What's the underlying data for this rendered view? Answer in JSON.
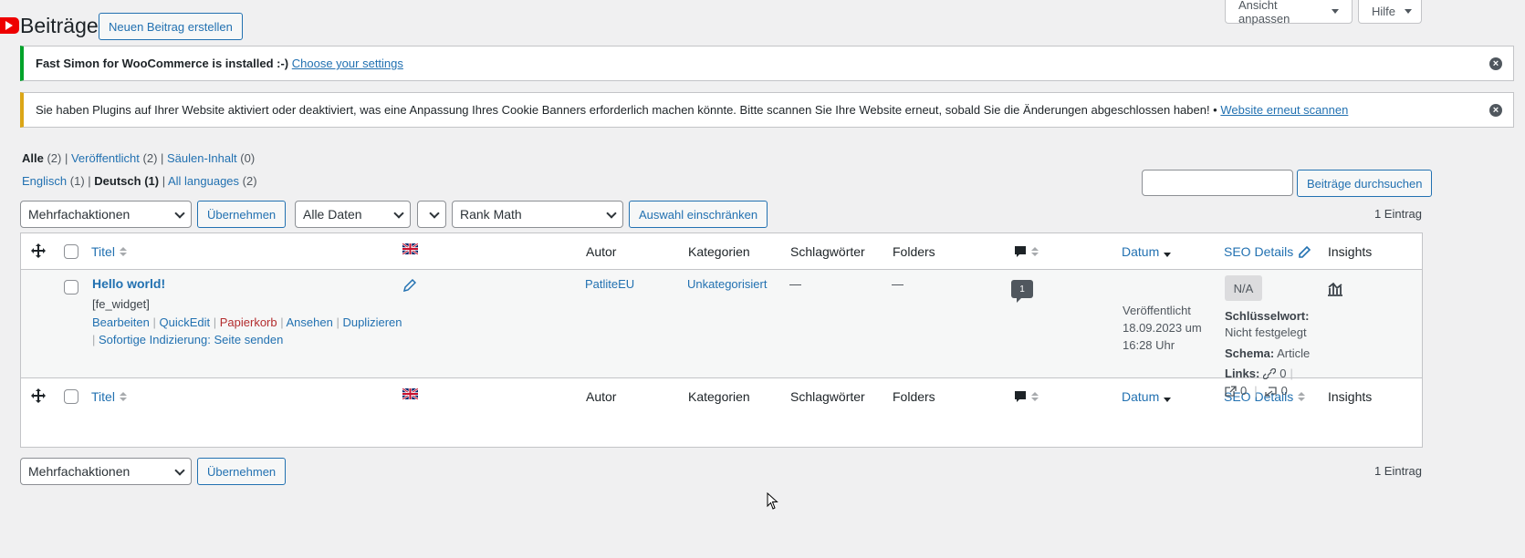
{
  "header": {
    "title": "Beiträge",
    "add_new": "Neuen Beitrag erstellen",
    "screen_options": "Ansicht anpassen",
    "help": "Hilfe"
  },
  "notices": {
    "fast_simon": {
      "text": "Fast Simon for WooCommerce is installed :-)",
      "link": "Choose your settings",
      "color": "#00a32a"
    },
    "cookie": {
      "text": "Sie haben Plugins auf Ihrer Website aktiviert oder deaktiviert, was eine Anpassung Ihres Cookie Banners erforderlich machen könnte. Bitte scannen Sie Ihre Website erneut, sobald Sie die Änderungen abgeschlossen haben! •",
      "link": "Website erneut scannen",
      "color": "#dba617"
    }
  },
  "views": {
    "all": "Alle",
    "all_count": "(2)",
    "published": "Veröffentlicht",
    "published_count": "(2)",
    "column_content": "Säulen-Inhalt",
    "column_content_count": "(0)"
  },
  "languages": {
    "english": "Englisch",
    "english_count": "(1)",
    "german": "Deutsch",
    "german_count": "(1)",
    "all": "All languages",
    "all_count": "(2)"
  },
  "search": {
    "value": "",
    "button": "Beiträge durchsuchen"
  },
  "filters": {
    "bulk_actions": "Mehrfachaktionen",
    "apply": "Übernehmen",
    "dates": "Alle Daten",
    "empty_select": "",
    "rank_math": "Rank Math",
    "filter_button": "Auswahl einschränken",
    "item_count": "1 Eintrag"
  },
  "columns": {
    "title": "Titel",
    "author": "Autor",
    "categories": "Kategorien",
    "tags": "Schlagwörter",
    "folders": "Folders",
    "date": "Datum",
    "seo": "SEO Details",
    "insights": "Insights"
  },
  "post": {
    "title": "Hello world!",
    "shortcode": "[fe_widget]",
    "actions": {
      "edit": "Bearbeiten",
      "quickedit": "QuickEdit",
      "trash": "Papierkorb",
      "view": "Ansehen",
      "duplicate": "Duplizieren",
      "indexing": "Sofortige Indizierung: Seite senden"
    },
    "author": "PatliteEU",
    "category": "Unkategorisiert",
    "tags": "—",
    "folders": "—",
    "comments": "1",
    "date_status": "Veröffentlicht",
    "date_line1": "18.09.2023 um",
    "date_line2": "16:28 Uhr",
    "seo": {
      "score": "N/A",
      "keyword_label": "Schlüsselwort:",
      "keyword_value": "Nicht festgelegt",
      "schema_label": "Schema:",
      "schema_value": "Article",
      "links_label": "Links:",
      "internal": "0",
      "external": "0",
      "incoming": "0"
    }
  },
  "footer": {
    "bulk_actions": "Mehrfachaktionen",
    "apply": "Übernehmen",
    "item_count": "1 Eintrag"
  }
}
